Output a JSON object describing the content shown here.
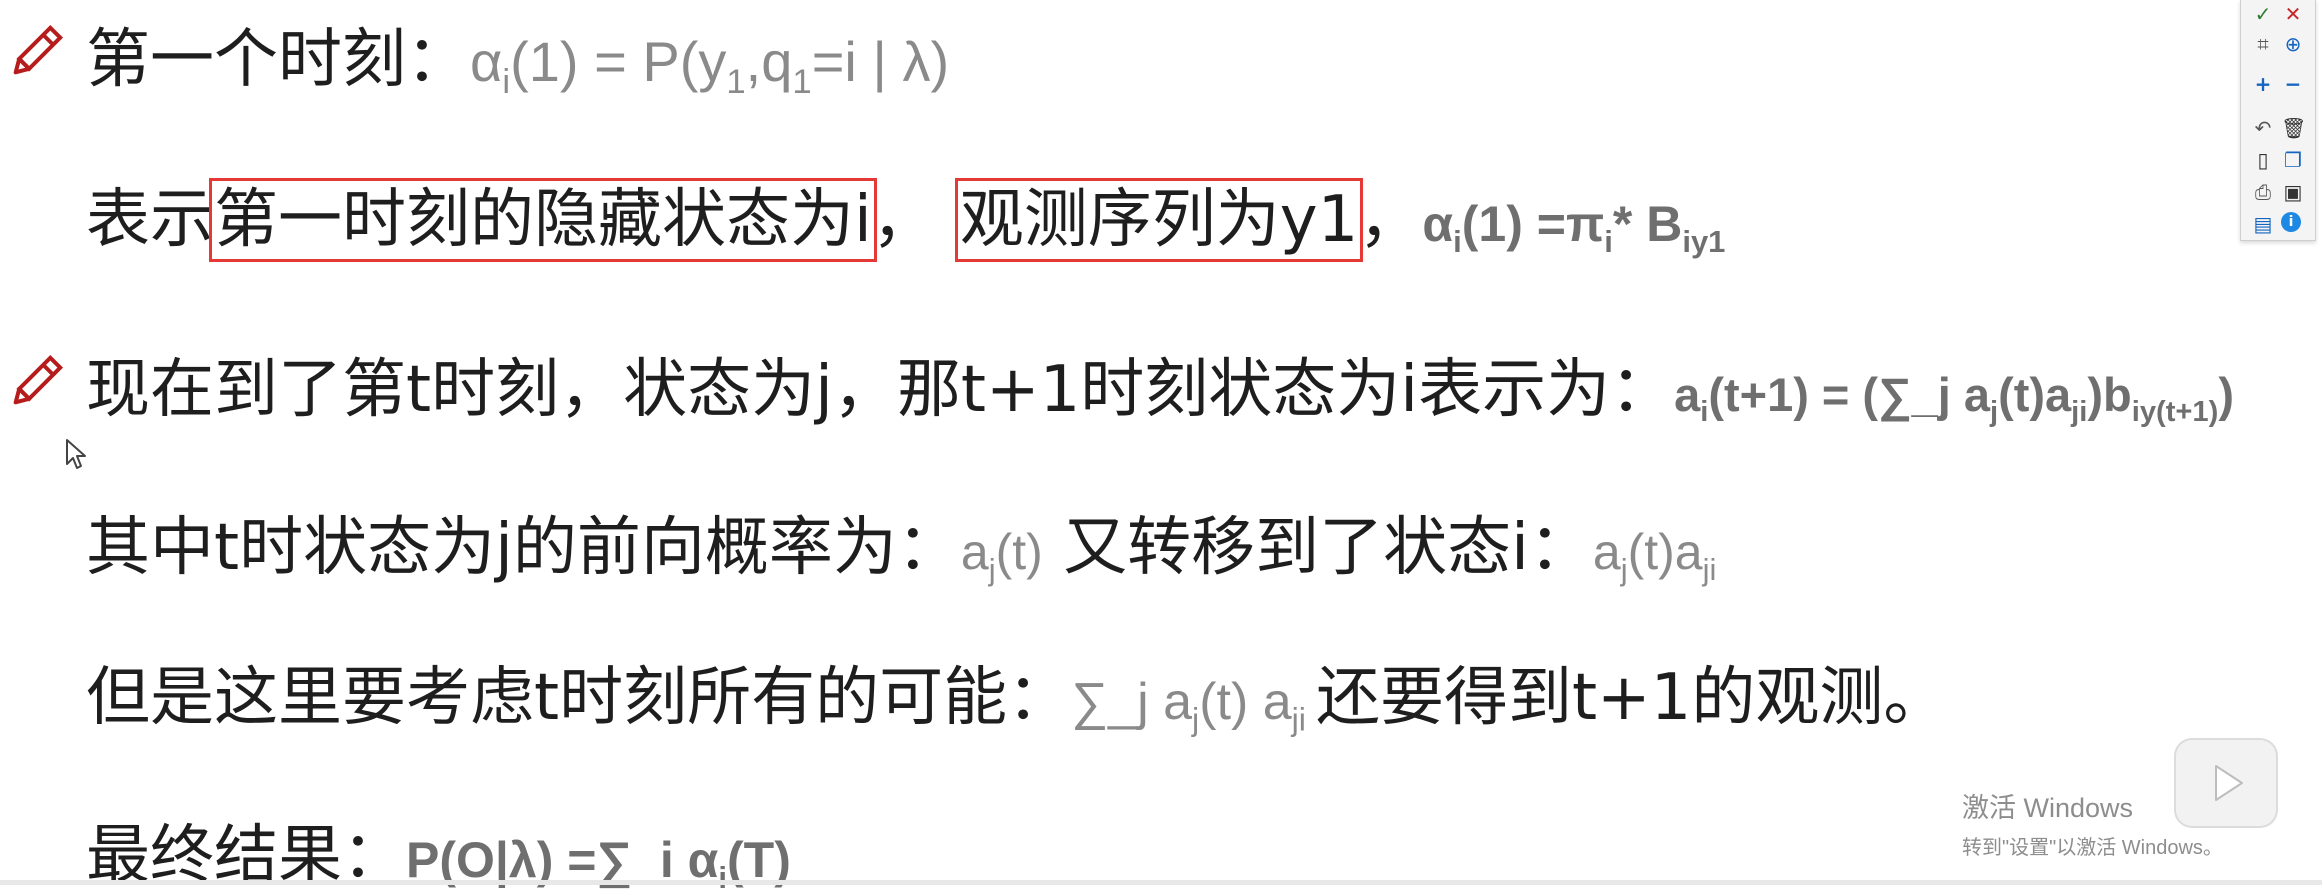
{
  "line1": {
    "zh": "第一个时刻：",
    "formula_alpha": "α",
    "formula_sub_i": "i",
    "formula_mid": "(1) = P(y",
    "formula_sub_1a": "1",
    "formula_comma_q": ",q",
    "formula_sub_1b": "1",
    "formula_end": "=i | λ)"
  },
  "line2": {
    "zh_prefix": "表示",
    "boxed1": "第一时刻的隐藏状态为i",
    "sep": "，",
    "boxed2": "观测序列为y1",
    "comma": "，",
    "formula_alpha": "α",
    "formula_sub_i": "i",
    "formula_mid": "(1) =π",
    "formula_sub_i2": "i",
    "formula_star": "* B",
    "formula_sub_iy1": "iy1"
  },
  "line3": {
    "zh": "现在到了第t时刻，状态为j，那t+1时刻状态为i表示为：",
    "f_a": "a",
    "f_sub_i": "i",
    "f_mid1": "(t+1) = (∑_j a",
    "f_sub_j": "j",
    "f_mid2": "(t)a",
    "f_sub_ji": "ji",
    "f_mid3": ")b",
    "f_sub_iy": "iy(t+1)",
    "f_end": ")"
  },
  "line4": {
    "zh1": "其中t时状态为j的前向概率为：",
    "f1_a": "a",
    "f1_sub": "j",
    "f1_rest": "(t)",
    "zh2": " 又转移到了状态i：",
    "f2_a": "a",
    "f2_sub": "j",
    "f2_mid": "(t)a",
    "f2_sub2": "ji"
  },
  "line5": {
    "zh1": "但是这里要考虑t时刻所有的可能：",
    "f_sum": "∑_j a",
    "f_sub_j": "j",
    "f_mid": "(t) a",
    "f_sub_ji": "ji",
    "zh2": "还要得到t+1的观测。"
  },
  "line6": {
    "zh": "最终结果：",
    "f_pre": "P(O|λ) =∑_i α",
    "f_sub": "i",
    "f_end": "(T)"
  },
  "watermark": {
    "line1": "激活 Windows",
    "line2": "转到\"设置\"以激活 Windows。"
  },
  "colors": {
    "pencil": "#b71c1c",
    "box_outline": "#e53935",
    "formula_gray": "#8a8a8a"
  },
  "icons": [
    "pencil-icon",
    "check-icon",
    "close-icon",
    "crop-icon",
    "zoom-icon",
    "plus-icon",
    "minus-icon",
    "undo-icon",
    "trash-icon",
    "new-page-icon",
    "copy-icon",
    "print-icon",
    "save-icon",
    "image-icon",
    "info-icon",
    "play-icon",
    "cursor-icon"
  ]
}
